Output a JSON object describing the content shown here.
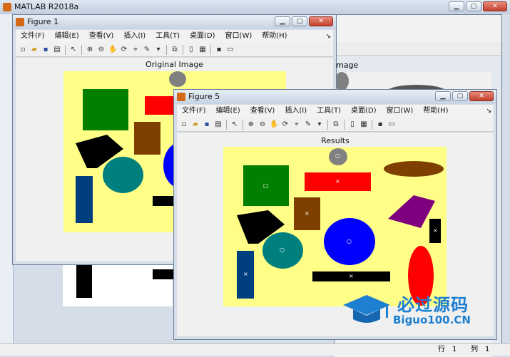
{
  "matlab": {
    "title": "MATLAB R2018a",
    "status_row_label": "行",
    "status_row_value": "1",
    "status_col_label": "列",
    "status_col_value": "1"
  },
  "figure1": {
    "title": "Figure 1",
    "axes_title": "Original Image",
    "axes_title_bg": "mage"
  },
  "figure5": {
    "title": "Figure 5",
    "axes_title": "Results"
  },
  "menus": [
    "文件(F)",
    "编辑(E)",
    "查看(V)",
    "插入(I)",
    "工具(T)",
    "桌面(D)",
    "窗口(W)",
    "帮助(H)"
  ],
  "controls": {
    "minimize": "▁",
    "maximize": "▢",
    "close": "✕"
  },
  "watermark": {
    "main": "必过源码",
    "site": "Biguo100.CN"
  },
  "colors": {
    "plot_bg": "#ffff88",
    "green": "#007f00",
    "red": "#ff0000",
    "brown": "#7f3f00",
    "blue": "#0000ff",
    "teal": "#007f7f",
    "navy": "#003f7f",
    "purple": "#7f007f",
    "gray": "#808080",
    "black": "#000000"
  }
}
